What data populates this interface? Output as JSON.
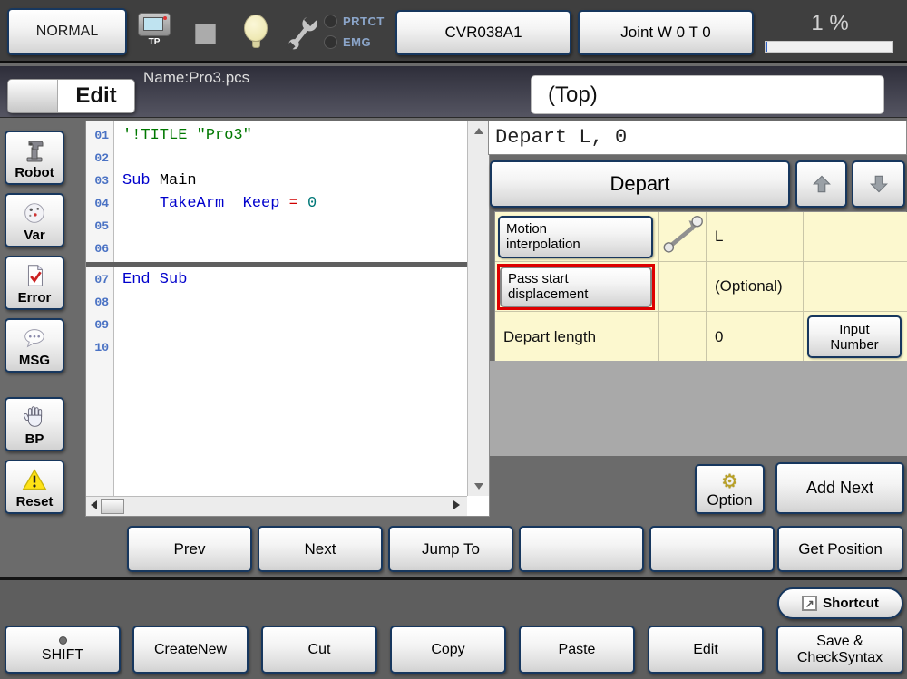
{
  "top_bar": {
    "mode_button": "NORMAL",
    "tp_label": "TP",
    "prtct_label": "PRTCT",
    "emg_label": "EMG",
    "controller_button": "CVR038A1",
    "joint_button": "Joint  W 0 T 0",
    "speed_text": "1 %",
    "speed_percent": 1
  },
  "tab_bar": {
    "tab_label": "Edit",
    "file_name": "Name:Pro3.pcs",
    "position_indicator": "(Top)"
  },
  "sidebar": {
    "items": [
      {
        "label": "Robot",
        "icon": "robot-icon"
      },
      {
        "label": "Var",
        "icon": "dice-icon"
      },
      {
        "label": "Error",
        "icon": "error-doc-icon"
      },
      {
        "label": "MSG",
        "icon": "message-icon"
      },
      {
        "label": "BP",
        "icon": "hand-icon"
      },
      {
        "label": "Reset",
        "icon": "warning-icon"
      }
    ]
  },
  "editor": {
    "lines": [
      {
        "num": "01",
        "segs": [
          {
            "t": "'!TITLE \"Pro3\"",
            "c": "comment"
          }
        ]
      },
      {
        "num": "02",
        "segs": []
      },
      {
        "num": "03",
        "segs": [
          {
            "t": "Sub ",
            "c": "kw"
          },
          {
            "t": "Main",
            "c": "id"
          }
        ]
      },
      {
        "num": "04",
        "segs": [
          {
            "t": "    ",
            "c": "id"
          },
          {
            "t": "TakeArm  Keep ",
            "c": "kw"
          },
          {
            "t": "= ",
            "c": "op"
          },
          {
            "t": "0",
            "c": "num"
          }
        ]
      },
      {
        "num": "05",
        "segs": []
      },
      {
        "num": "06",
        "segs": [],
        "divider_after": true
      },
      {
        "num": "07",
        "segs": [
          {
            "t": "End Sub",
            "c": "kw"
          }
        ]
      },
      {
        "num": "08",
        "segs": []
      },
      {
        "num": "09",
        "segs": []
      },
      {
        "num": "10",
        "segs": []
      }
    ]
  },
  "command_panel": {
    "statement": "Depart L, 0",
    "command_button": "Depart",
    "table_rows": [
      {
        "label": "Motion\ninterpolation",
        "label_type": "button",
        "icon": "motion-line-icon",
        "value": "L",
        "action": null,
        "highlight": false
      },
      {
        "label": "Pass start\ndisplacement",
        "label_type": "button",
        "icon": null,
        "value": "(Optional)",
        "action": null,
        "highlight": true
      },
      {
        "label": "Depart length",
        "label_type": "text",
        "icon": null,
        "value": "0",
        "action": "Input\nNumber",
        "highlight": false
      }
    ],
    "option_button": "Option",
    "add_next_button": "Add Next"
  },
  "nav_buttons": [
    {
      "label": "Prev"
    },
    {
      "label": "Next"
    },
    {
      "label": "Jump To"
    },
    {
      "label": ""
    },
    {
      "label": ""
    },
    {
      "label": "Get Position"
    }
  ],
  "shortcut_button": "Shortcut",
  "bottom_buttons": [
    {
      "label": "SHIFT",
      "led": true
    },
    {
      "label": "CreateNew"
    },
    {
      "label": "Cut"
    },
    {
      "label": "Copy"
    },
    {
      "label": "Paste"
    },
    {
      "label": "Edit"
    },
    {
      "label": "Save &\nCheckSyntax"
    }
  ],
  "colors": {
    "accent_border": "#17375e",
    "highlight_red": "#dd0000",
    "table_bg": "#fcf8cf",
    "comment_green": "#007800",
    "keyword_blue": "#0000cc",
    "operator_red": "#d00000",
    "number_teal": "#007878"
  }
}
